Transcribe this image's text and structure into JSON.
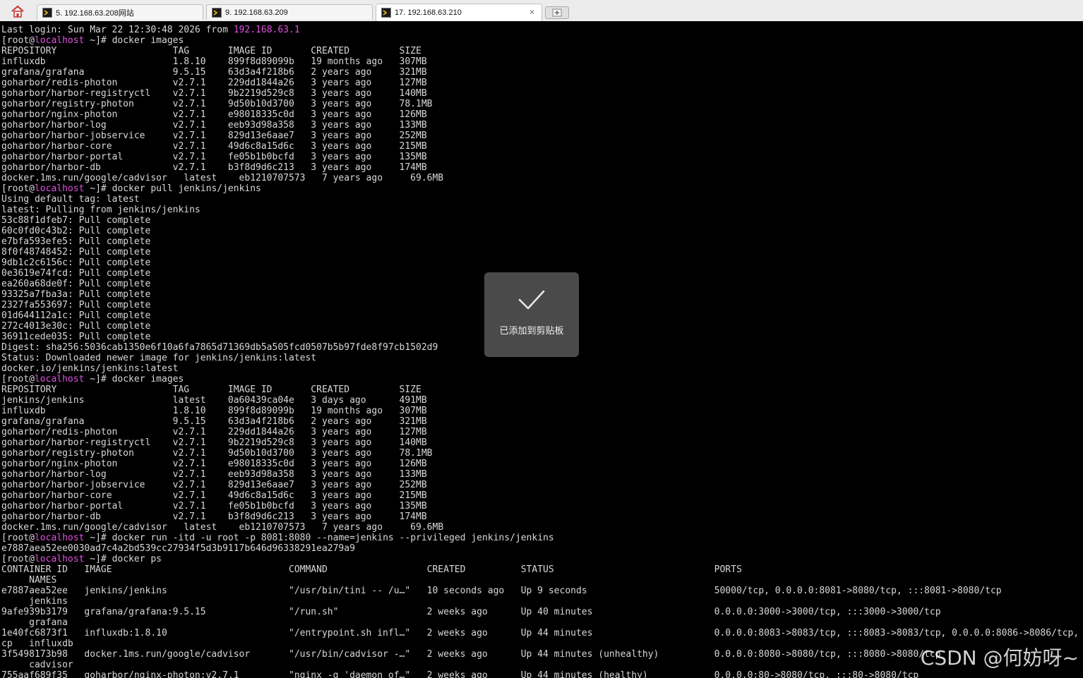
{
  "tabs": [
    {
      "label": "5. 192.168.63.208网站"
    },
    {
      "label": "9. 192.168.63.209"
    },
    {
      "label": "17. 192.168.63.210",
      "close": "×"
    }
  ],
  "terminal": {
    "login_prefix": "Last login: Sun Mar 22 12:30:48 2026 from ",
    "login_ip": "192.168.63.1",
    "prompt_user": "[root@",
    "prompt_host": "localhost",
    "prompt_suffix": " ~]# ",
    "cmd_images": "docker images",
    "cmd_pull": "docker pull jenkins/jenkins",
    "cmd_run": "docker run -itd -u root -p 8081:8080 --name=jenkins --privileged jenkins/jenkins",
    "cmd_ps": "docker ps",
    "images_header": "REPOSITORY                     TAG       IMAGE ID       CREATED         SIZE",
    "images_list_1": [
      "influxdb                       1.8.10    899f8d89099b   19 months ago   307MB",
      "grafana/grafana                9.5.15    63d3a4f218b6   2 years ago     321MB",
      "goharbor/redis-photon          v2.7.1    229dd1844a26   3 years ago     127MB",
      "goharbor/harbor-registryctl    v2.7.1    9b2219d529c8   3 years ago     140MB",
      "goharbor/registry-photon       v2.7.1    9d50b10d3700   3 years ago     78.1MB",
      "goharbor/nginx-photon          v2.7.1    e98018335c0d   3 years ago     126MB",
      "goharbor/harbor-log            v2.7.1    eeb93d98a358   3 years ago     133MB",
      "goharbor/harbor-jobservice     v2.7.1    829d13e6aae7   3 years ago     252MB",
      "goharbor/harbor-core           v2.7.1    49d6c8a15d6c   3 years ago     215MB",
      "goharbor/harbor-portal         v2.7.1    fe05b1b0bcfd   3 years ago     135MB",
      "goharbor/harbor-db             v2.7.1    b3f8d9d6c213   3 years ago     174MB",
      "docker.1ms.run/google/cadvisor   latest    eb1210707573   7 years ago     69.6MB"
    ],
    "pull_output": [
      "Using default tag: latest",
      "latest: Pulling from jenkins/jenkins",
      "53c88f1dfeb7: Pull complete",
      "60c0fd0c43b2: Pull complete",
      "e7bfa593efe5: Pull complete",
      "8f0f48748452: Pull complete",
      "9db1c2c6156c: Pull complete",
      "0e3619e74fcd: Pull complete",
      "ea260a68de0f: Pull complete",
      "93325a7fba3a: Pull complete",
      "2327fa553697: Pull complete",
      "01d644112a1c: Pull complete",
      "272c4013e30c: Pull complete",
      "36911cede035: Pull complete",
      "Digest: sha256:5036cab1350e6f10a6fa7865d71369db5a505fcd0507b5b97fde8f97cb1502d9",
      "Status: Downloaded newer image for jenkins/jenkins:latest",
      "docker.io/jenkins/jenkins:latest"
    ],
    "images_list_2": [
      "jenkins/jenkins                latest    0a60439ca04e   3 days ago      491MB",
      "influxdb                       1.8.10    899f8d89099b   19 months ago   307MB",
      "grafana/grafana                9.5.15    63d3a4f218b6   2 years ago     321MB",
      "goharbor/redis-photon          v2.7.1    229dd1844a26   3 years ago     127MB",
      "goharbor/harbor-registryctl    v2.7.1    9b2219d529c8   3 years ago     140MB",
      "goharbor/registry-photon       v2.7.1    9d50b10d3700   3 years ago     78.1MB",
      "goharbor/nginx-photon          v2.7.1    e98018335c0d   3 years ago     126MB",
      "goharbor/harbor-log            v2.7.1    eeb93d98a358   3 years ago     133MB",
      "goharbor/harbor-jobservice     v2.7.1    829d13e6aae7   3 years ago     252MB",
      "goharbor/harbor-core           v2.7.1    49d6c8a15d6c   3 years ago     215MB",
      "goharbor/harbor-portal         v2.7.1    fe05b1b0bcfd   3 years ago     135MB",
      "goharbor/harbor-db             v2.7.1    b3f8d9d6c213   3 years ago     174MB",
      "docker.1ms.run/google/cadvisor   latest    eb1210707573   7 years ago     69.6MB"
    ],
    "run_output": "e7887aea52ee0030ad7c4a2bd539cc27934f5d3b9117b646d96338291ea279a9",
    "ps_output": [
      "CONTAINER ID   IMAGE                                COMMAND                  CREATED          STATUS                             PORTS",
      "     NAMES",
      "e7887aea52ee   jenkins/jenkins                      \"/usr/bin/tini -- /u…\"   10 seconds ago   Up 9 seconds                       50000/tcp, 0.0.0.0:8081->8080/tcp, :::8081->8080/tcp",
      "     jenkins",
      "9afe939b3179   grafana/grafana:9.5.15               \"/run.sh\"                2 weeks ago      Up 40 minutes                      0.0.0.0:3000->3000/tcp, :::3000->3000/tcp",
      "     grafana",
      "1e40fc6873f1   influxdb:1.8.10                      \"/entrypoint.sh infl…\"   2 weeks ago      Up 44 minutes                      0.0.0.0:8083->8083/tcp, :::8083->8083/tcp, 0.0.0.0:8086->8086/tcp, :::8086->8086/t",
      "cp   influxdb",
      "3f5498173b98   docker.1ms.run/google/cadvisor       \"/usr/bin/cadvisor -…\"   2 weeks ago      Up 44 minutes (unhealthy)          0.0.0.0:8080->8080/tcp, :::8080->8080/tcp",
      "     cadvisor",
      "755aaf689f35   goharbor/nginx-photon:v2.7.1         \"nginx -g 'daemon of…\"   2 weeks ago      Up 44 minutes (healthy)            0.0.0.0:80->8080/tcp, :::80->8080/tcp"
    ]
  },
  "toast": {
    "message": "已添加到剪贴板"
  },
  "watermark": "CSDN @何妨呀~",
  "colors": {
    "host": "#e052e0",
    "terminal_bg": "#000000",
    "terminal_fg": "#d8d8d8",
    "toast_bg": "#4a4a4a"
  },
  "icons": [
    "home-icon",
    "terminal-session-icon",
    "close-icon",
    "new-tab-icon",
    "checkmark-icon"
  ]
}
